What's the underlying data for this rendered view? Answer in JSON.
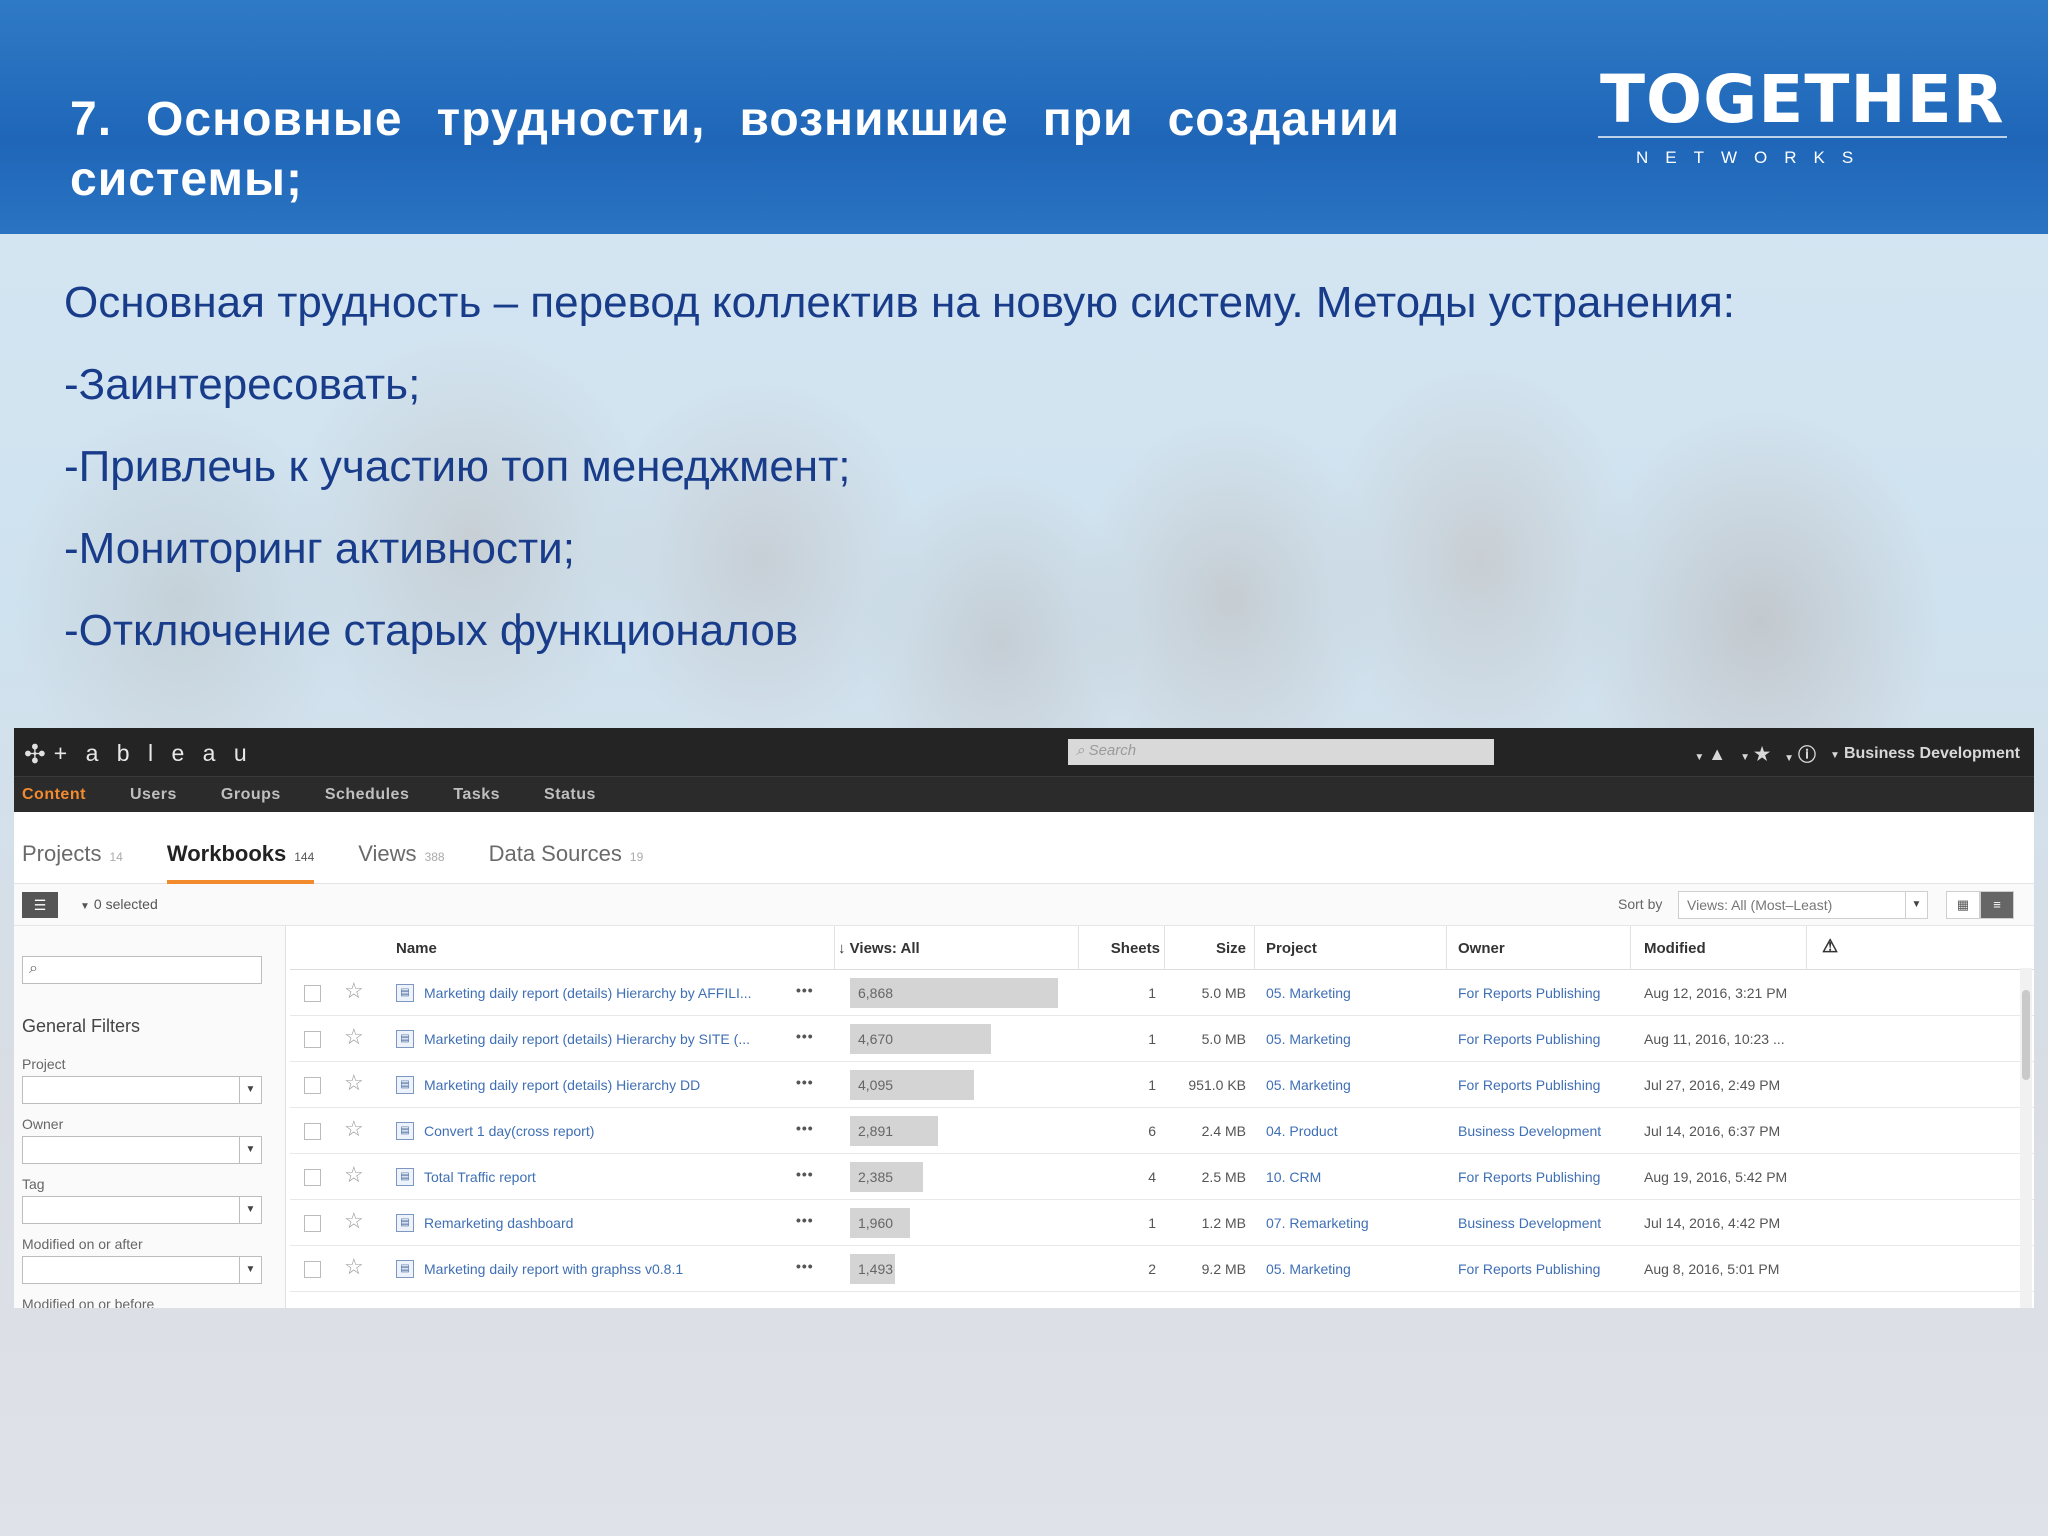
{
  "slide": {
    "title": "7. Основные трудности, возникшие при создании системы;",
    "logo_main": "TOGETHER",
    "logo_sub": "NETWORKS",
    "lines": [
      "Основная трудность – перевод коллектив на новую систему. Методы устранения:",
      "-Заинтересовать;",
      "-Привлечь к участию топ менеджмент;",
      "-Мониторинг активности;",
      "-Отключение старых функционалов"
    ]
  },
  "tableau": {
    "logo_text": "+ a b l e a u",
    "search_placeholder": "Search",
    "user": "Business Development",
    "nav": [
      "Content",
      "Users",
      "Groups",
      "Schedules",
      "Tasks",
      "Status"
    ],
    "tabs": [
      {
        "label": "Projects",
        "count": "14"
      },
      {
        "label": "Workbooks",
        "count": "144"
      },
      {
        "label": "Views",
        "count": "388"
      },
      {
        "label": "Data Sources",
        "count": "19"
      }
    ],
    "selected": "0 selected",
    "sort_by_label": "Sort by",
    "sort_value": "Views: All (Most–Least)",
    "sidebar": {
      "general_filters": "General Filters",
      "project": "Project",
      "owner": "Owner",
      "tag": "Tag",
      "modified_after": "Modified on or after",
      "modified_before": "Modified on or before"
    },
    "columns": {
      "name": "Name",
      "views": "Views: All",
      "sheets": "Sheets",
      "size": "Size",
      "project": "Project",
      "owner": "Owner",
      "modified": "Modified"
    },
    "rows": [
      {
        "name": "Marketing daily report (details) Hierarchy by AFFILI...",
        "views": "6,868",
        "views_pct": 0.97,
        "sheets": "1",
        "size": "5.0 MB",
        "project": "05. Marketing",
        "owner": "For Reports Publishing",
        "modified": "Aug 12, 2016, 3:21 PM"
      },
      {
        "name": "Marketing daily report (details) Hierarchy by SITE (...",
        "views": "4,670",
        "views_pct": 0.66,
        "sheets": "1",
        "size": "5.0 MB",
        "project": "05. Marketing",
        "owner": "For Reports Publishing",
        "modified": "Aug 11, 2016, 10:23 ..."
      },
      {
        "name": "Marketing daily report (details) Hierarchy DD",
        "views": "4,095",
        "views_pct": 0.58,
        "sheets": "1",
        "size": "951.0 KB",
        "project": "05. Marketing",
        "owner": "For Reports Publishing",
        "modified": "Jul 27, 2016, 2:49 PM"
      },
      {
        "name": "Convert 1 day(cross report)",
        "views": "2,891",
        "views_pct": 0.41,
        "sheets": "6",
        "size": "2.4 MB",
        "project": "04. Product",
        "owner": "Business Development",
        "modified": "Jul 14, 2016, 6:37 PM"
      },
      {
        "name": "Total Traffic report",
        "views": "2,385",
        "views_pct": 0.34,
        "sheets": "4",
        "size": "2.5 MB",
        "project": "10. CRM",
        "owner": "For Reports Publishing",
        "modified": "Aug 19, 2016, 5:42 PM"
      },
      {
        "name": "Remarketing dashboard",
        "views": "1,960",
        "views_pct": 0.28,
        "sheets": "1",
        "size": "1.2 MB",
        "project": "07. Remarketing",
        "owner": "Business Development",
        "modified": "Jul 14, 2016, 4:42 PM"
      },
      {
        "name": "Marketing daily report with graphss v0.8.1",
        "views": "1,493",
        "views_pct": 0.21,
        "sheets": "2",
        "size": "9.2 MB",
        "project": "05. Marketing",
        "owner": "For Reports Publishing",
        "modified": "Aug 8, 2016, 5:01 PM"
      }
    ]
  }
}
